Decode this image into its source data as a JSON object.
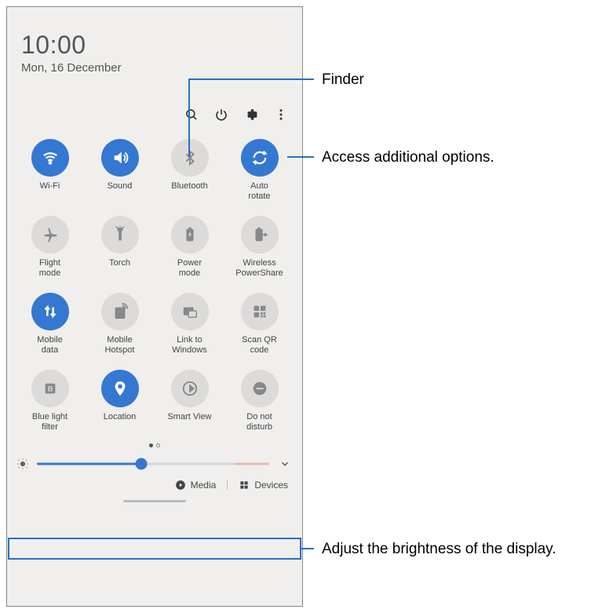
{
  "header": {
    "time": "10:00",
    "date": "Mon, 16 December"
  },
  "toolbar": {
    "search": "Finder",
    "power": "Power",
    "settings": "Settings",
    "more": "More options"
  },
  "tiles": [
    {
      "label": "Wi-Fi",
      "active": true
    },
    {
      "label": "Sound",
      "active": true
    },
    {
      "label": "Bluetooth",
      "active": false
    },
    {
      "label": "Auto\nrotate",
      "active": true
    },
    {
      "label": "Flight\nmode",
      "active": false
    },
    {
      "label": "Torch",
      "active": false
    },
    {
      "label": "Power\nmode",
      "active": false
    },
    {
      "label": "Wireless\nPowerShare",
      "active": false
    },
    {
      "label": "Mobile\ndata",
      "active": true
    },
    {
      "label": "Mobile\nHotspot",
      "active": false
    },
    {
      "label": "Link to\nWindows",
      "active": false
    },
    {
      "label": "Scan QR\ncode",
      "active": false
    },
    {
      "label": "Blue light\nfilter",
      "active": false
    },
    {
      "label": "Location",
      "active": true
    },
    {
      "label": "Smart View",
      "active": false
    },
    {
      "label": "Do not\ndisturb",
      "active": false
    }
  ],
  "brightness": {
    "value": 45,
    "max": 100
  },
  "bottom": {
    "media": "Media",
    "devices": "Devices"
  },
  "annotations": {
    "finder": "Finder",
    "more": "Access additional options.",
    "brightness": "Adjust the brightness of the display."
  }
}
